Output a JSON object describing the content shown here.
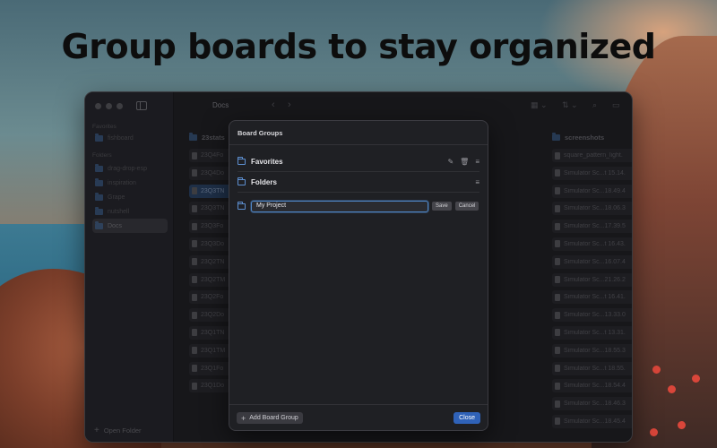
{
  "headline": "Group boards to stay organized",
  "sidebar": {
    "favorites_header": "Favorites",
    "favorites": [
      "fishboard"
    ],
    "folders_header": "Folders",
    "folders": [
      "drag-drop-esp",
      "inspiration",
      "Grape",
      "nutshell",
      "Docs"
    ],
    "active_folder": "Docs",
    "open_folder_label": "Open Folder"
  },
  "toolbar": {
    "title": "Docs"
  },
  "columns": [
    {
      "name": "23stats",
      "files": [
        "23Q4Fo",
        "23Q4Do",
        "23Q3TN",
        "23Q3TN",
        "23Q3Fo",
        "23Q3Do",
        "23Q2TN",
        "23Q2TM",
        "23Q2Fo",
        "23Q2Do",
        "23Q1TN",
        "23Q1TM",
        "23Q1Fo",
        "23Q1Do"
      ],
      "selected_index": 2
    },
    {
      "name": "screenshots",
      "files": [
        "square_pattern_light.",
        "Simulator Sc...t 15.14.",
        "Simulator Sc...18.49.4",
        "Simulator Sc...18.06.3",
        "Simulator Sc...17.39.5",
        "Simulator Sc...t 16.43.",
        "Simulator Sc...16.07.4",
        "Simulator Sc...21.26.2",
        "Simulator Sc...t 16.41.",
        "Simulator Sc...13.33.0",
        "Simulator Sc...t 13.31.",
        "Simulator Sc...18.55.3",
        "Simulator Sc...t 18.55.",
        "Simulator Sc...18.54.4",
        "Simulator Sc...18.46.3",
        "Simulator Sc...18.45.4"
      ]
    }
  ],
  "modal": {
    "title": "Board Groups",
    "groups": [
      {
        "label": "Favorites"
      },
      {
        "label": "Folders"
      }
    ],
    "edit": {
      "value": "My Project",
      "save_label": "Save",
      "cancel_label": "Cancel"
    },
    "add_label": "Add Board Group",
    "close_label": "Close"
  },
  "colors": {
    "accent": "#2f62b8",
    "focus_ring": "#4f86c6"
  }
}
